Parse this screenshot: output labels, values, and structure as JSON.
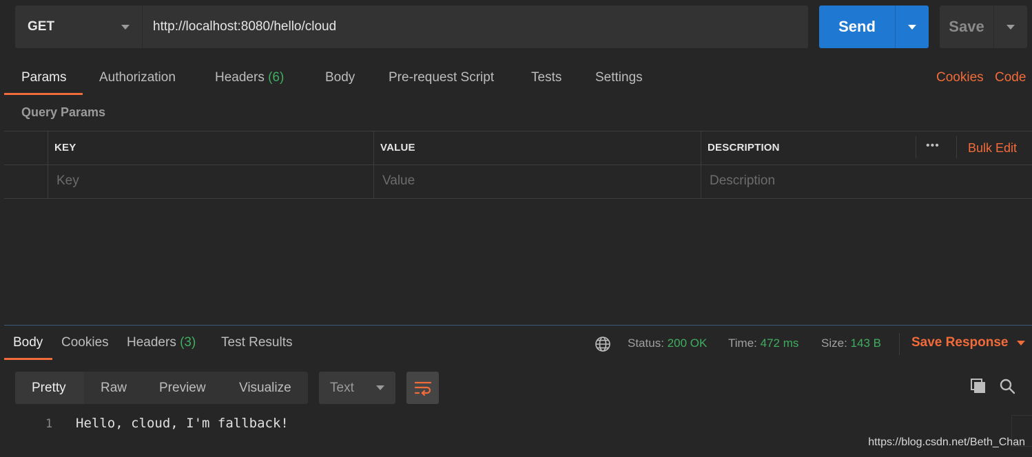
{
  "request": {
    "method": "GET",
    "url": "http://localhost:8080/hello/cloud",
    "send_label": "Send",
    "save_label": "Save"
  },
  "request_tabs": [
    {
      "label": "Params"
    },
    {
      "label": "Authorization"
    },
    {
      "label": "Headers",
      "count": "(6)"
    },
    {
      "label": "Body"
    },
    {
      "label": "Pre-request Script"
    },
    {
      "label": "Tests"
    },
    {
      "label": "Settings"
    }
  ],
  "right_links": {
    "cookies": "Cookies",
    "code": "Code"
  },
  "query_params": {
    "title": "Query Params",
    "columns": {
      "key": "KEY",
      "value": "VALUE",
      "description": "DESCRIPTION"
    },
    "more": "•••",
    "bulk_edit": "Bulk Edit",
    "placeholders": {
      "key": "Key",
      "value": "Value",
      "description": "Description"
    }
  },
  "response": {
    "tabs": [
      {
        "label": "Body"
      },
      {
        "label": "Cookies"
      },
      {
        "label": "Headers",
        "count": "(3)"
      },
      {
        "label": "Test Results"
      }
    ],
    "status_label": "Status:",
    "status_value": "200 OK",
    "time_label": "Time:",
    "time_value": "472 ms",
    "size_label": "Size:",
    "size_value": "143 B",
    "save_response": "Save Response",
    "formats": [
      "Pretty",
      "Raw",
      "Preview",
      "Visualize"
    ],
    "language": "Text",
    "body_lines": [
      {
        "n": "1",
        "text": "Hello, cloud, I'm fallback!"
      }
    ]
  },
  "watermark": "https://blog.csdn.net/Beth_Chan",
  "colors": {
    "accent": "#f26b3a",
    "send": "#1f78d1",
    "success": "#3fae5f",
    "background": "#262626"
  }
}
